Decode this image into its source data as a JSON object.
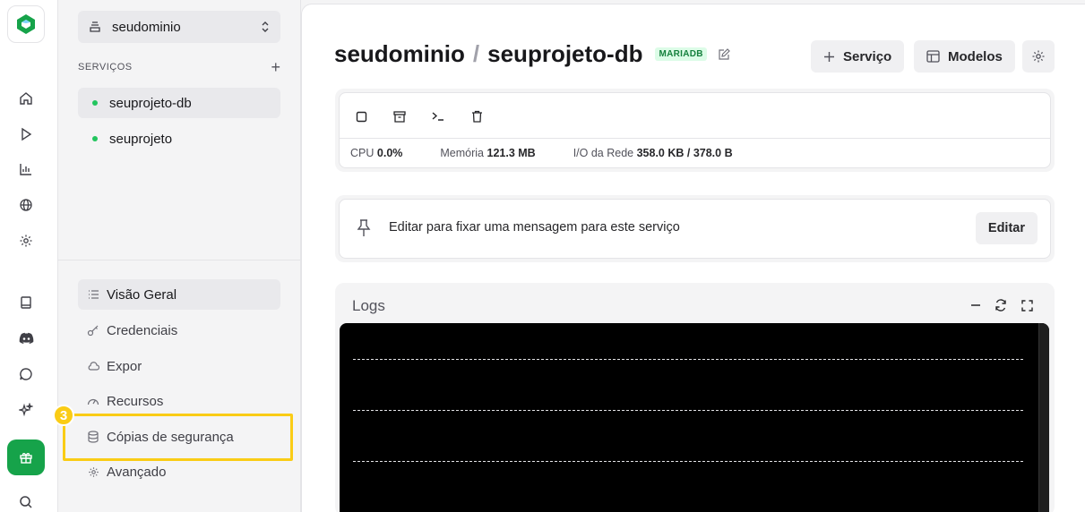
{
  "sidebar_panel": {
    "project_name": "seudominio",
    "services_label": "SERVIÇOS",
    "add_symbol": "+",
    "services": [
      {
        "name": "seuprojeto-db",
        "status_color": "#22c55e"
      },
      {
        "name": "seuprojeto",
        "status_color": "#22c55e"
      }
    ],
    "nav": [
      {
        "label": "Visão Geral",
        "icon": "list-icon"
      },
      {
        "label": "Credenciais",
        "icon": "key-icon"
      },
      {
        "label": "Expor",
        "icon": "cloud-icon"
      },
      {
        "label": "Recursos",
        "icon": "gauge-icon"
      },
      {
        "label": "Cópias de segurança",
        "icon": "database-icon"
      },
      {
        "label": "Avançado",
        "icon": "gear-icon"
      }
    ],
    "step_badge": "3",
    "highlight_color": "#facc15"
  },
  "header": {
    "project": "seudominio",
    "separator": "/",
    "service": "seuprojeto-db",
    "db_tag": "MARIADB",
    "service_button": "Serviço",
    "models_button": "Modelos"
  },
  "metrics": {
    "cpu_label": "CPU",
    "cpu_value": "0.0%",
    "memory_label": "Memória",
    "memory_value": "121.3 MB",
    "network_label": "I/O da Rede",
    "network_value": "358.0 KB / 378.0 B"
  },
  "pin_card": {
    "message": "Editar para fixar uma mensagem para este serviço",
    "edit_button": "Editar"
  },
  "logs": {
    "title": "Logs"
  },
  "colors": {
    "accent": "#16a34a",
    "status_green": "#22c55e",
    "tag_bg": "#dcfce7",
    "tag_text": "#15803d"
  }
}
